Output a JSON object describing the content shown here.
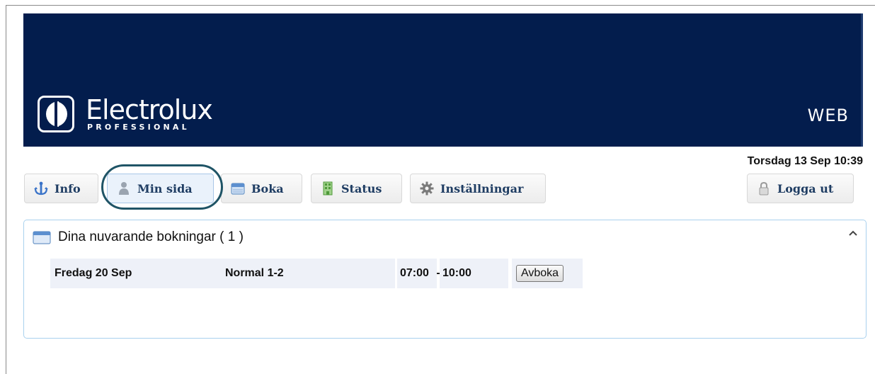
{
  "header": {
    "brand_name": "Electrolux",
    "brand_sub": "PROFESSIONAL",
    "product_label": "WEB",
    "brand_color": "#031d4d"
  },
  "datetime": "Torsdag 13 Sep 10:39",
  "nav": {
    "items": [
      {
        "label": "Info",
        "icon": "info-anchor-icon",
        "active": false
      },
      {
        "label": "Min sida",
        "icon": "user-icon",
        "active": true
      },
      {
        "label": "Boka",
        "icon": "calendar-icon",
        "active": false
      },
      {
        "label": "Status",
        "icon": "building-icon",
        "active": false
      },
      {
        "label": "Inställningar",
        "icon": "gear-icon",
        "active": false
      }
    ],
    "logout_label": "Logga ut"
  },
  "bookings": {
    "title": "Dina nuvarande bokningar ( 1 )",
    "rows": [
      {
        "day": "Fredag 20 Sep",
        "type": "Normal 1-2",
        "start": "07:00",
        "separator": "-",
        "end": "10:00",
        "action_label": "Avboka"
      }
    ]
  }
}
